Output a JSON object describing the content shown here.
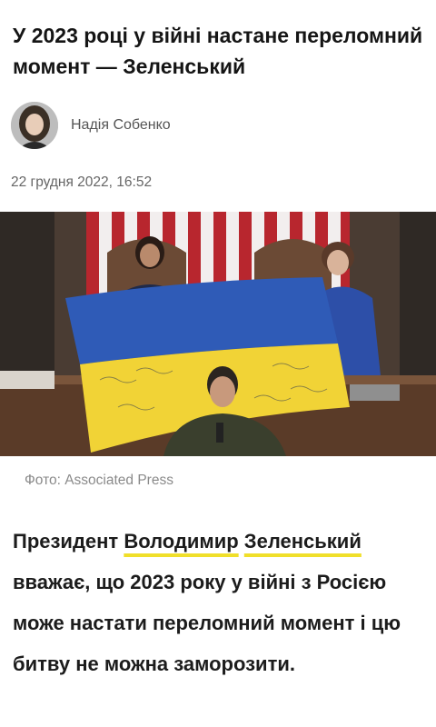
{
  "article": {
    "headline": "У 2023 році у війні настане переломний момент — Зеленський",
    "author": {
      "name": "Надія Собенко",
      "avatar_icon": "author-avatar-photo"
    },
    "date": "22 грудня 2022, 16:52",
    "photo": {
      "description_icon": "news-photo",
      "caption": "Фото: Associated Press"
    },
    "lead": {
      "pre": "Президент ",
      "link1": "Володимир",
      "space": " ",
      "link2": "Зеленський",
      "post": " вважає, що 2023 року у війні з Росією може настати переломний момент і цю битву не можна заморозити."
    }
  },
  "colors": {
    "link_underline": "#f0df2a",
    "flag_blue": "#2f5bb7",
    "flag_yellow": "#f1d336"
  }
}
